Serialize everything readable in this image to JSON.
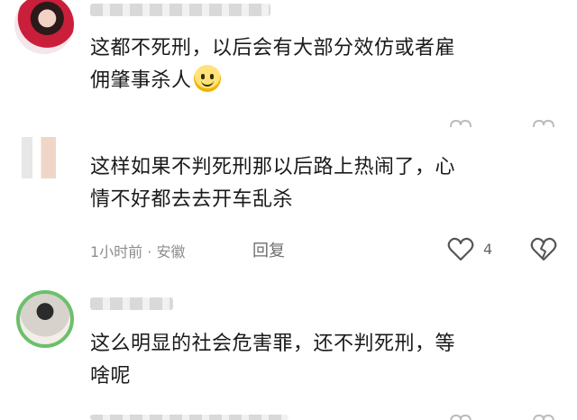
{
  "comments": [
    {
      "text_line1": "这都不死刑，以后会有大部分效仿或者雇",
      "text_line2": "佣肇事杀人",
      "emoji": "smile-emoji"
    },
    {
      "text_line1": "这样如果不判死刑那以后路上热闹了，心",
      "text_line2": "情不好都去去开车乱杀",
      "time_location": "1小时前 · 安徽",
      "reply_label": "回复",
      "like_count": "4"
    },
    {
      "text_line1": "这么明显的社会危害罪，还不判死刑，等",
      "text_line2": "啥呢"
    }
  ],
  "icons": {
    "like": "heart-icon",
    "dislike": "broken-heart-icon"
  },
  "colors": {
    "text": "#1a1a1a",
    "meta": "#8d8d8d",
    "avatar_ring": "#6cc06c"
  }
}
